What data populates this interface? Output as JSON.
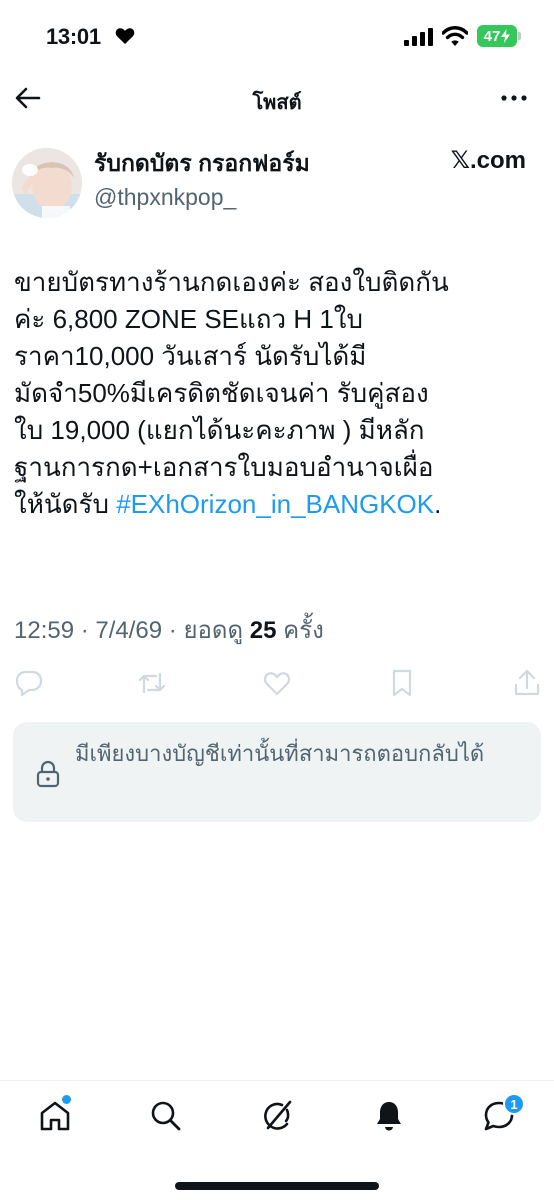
{
  "status_bar": {
    "time": "13:01",
    "battery": "47"
  },
  "header": {
    "title": "โพสต์"
  },
  "author": {
    "display_name": "รับกดบัตร กรอกฟอร์ม",
    "handle": "@thpxnkpop_"
  },
  "source": {
    "label": "𝕏.com"
  },
  "tweet": {
    "text": "ขายบัตรทางร้านกดเองค่ะ สองใบติดกัน\nค่ะ  6,800  ZONE SEแถว H   1ใบ\nราคา10,000 วันเสาร์ นัดรับได้มี\nมัดจำ50%มีเครดิตชัดเจนค่า  รับคู่สอง\nใบ 19,000 (แยกได้นะคะภาพ )  มีหลัก\nฐานการกด+เอกสารใบมอบอำนาจเผื่อ\nให้นัดรับ ",
    "hashtag": "#EXhOrizon_in_BANGKOK",
    "trailing": "."
  },
  "meta": {
    "time": "12:59",
    "date": "7/4/69",
    "views_label": "ยอดดู",
    "views_count": "25",
    "views_unit": "ครั้ง"
  },
  "reply_notice": {
    "text": "มีเพียงบางบัญชีเท่านั้นที่สามารถตอบกลับได้"
  },
  "tabbar": {
    "messages_badge": "1"
  },
  "colors": {
    "accent": "#1d9bf0",
    "battery": "#34c759",
    "muted": "#536471"
  },
  "icons": [
    "heart-icon",
    "signal-icon",
    "wifi-icon",
    "back-icon",
    "more-icon",
    "reply-icon",
    "repost-icon",
    "like-icon",
    "bookmark-icon",
    "share-icon",
    "lock-icon",
    "home-icon",
    "search-icon",
    "grok-icon",
    "notifications-icon",
    "messages-icon"
  ]
}
